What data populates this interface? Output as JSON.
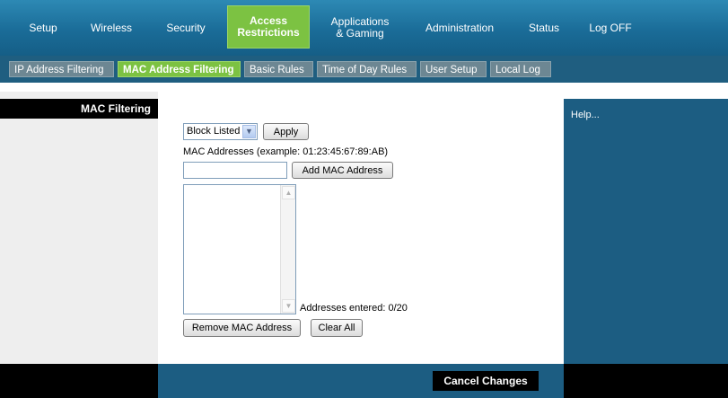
{
  "topnav": {
    "setup": "Setup",
    "wireless": "Wireless",
    "security": "Security",
    "access_line1": "Access",
    "access_line2": "Restrictions",
    "apps_line1": "Applications",
    "apps_line2": "& Gaming",
    "administration": "Administration",
    "status": "Status",
    "logoff": "Log OFF"
  },
  "subnav": {
    "ip_filter": "IP Address Filtering",
    "mac_filter": "MAC Address Filtering",
    "basic_rules": "Basic Rules",
    "time_rules": "Time of Day Rules",
    "user_setup": "User Setup",
    "local_log": "Local Log"
  },
  "sidebar": {
    "heading": "MAC Filtering"
  },
  "form": {
    "mode_select": "Block Listed",
    "apply": "Apply",
    "mac_label": "MAC Addresses (example: 01:23:45:67:89:AB)",
    "add_mac": "Add MAC Address",
    "mac_input_value": "",
    "addresses_entered": "Addresses entered: 0/20",
    "remove_mac": "Remove MAC Address",
    "clear_all": "Clear All"
  },
  "help": {
    "text": "Help..."
  },
  "footer": {
    "cancel": "Cancel Changes"
  },
  "colors": {
    "accent_green": "#7cc242",
    "nav_blue": "#1a6c98",
    "panel_blue": "#1c5d82"
  }
}
